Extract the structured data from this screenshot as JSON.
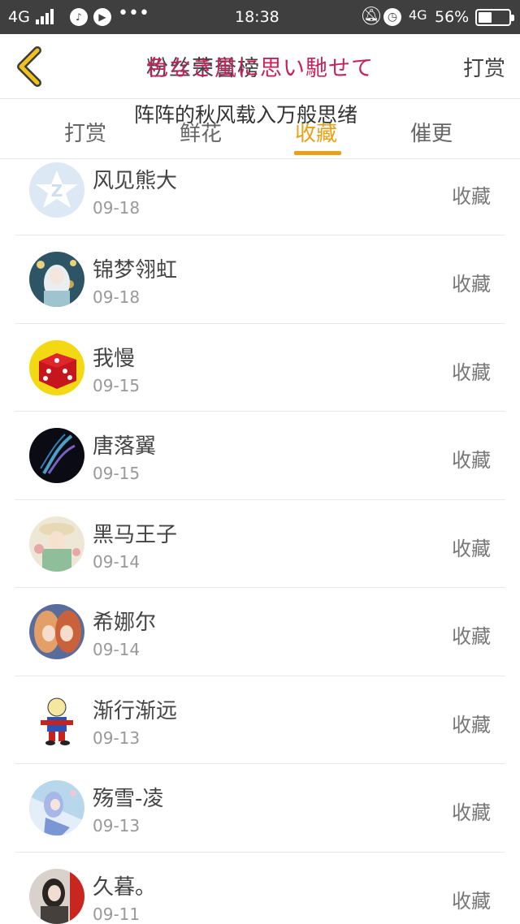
{
  "status_bar": {
    "network": "4G",
    "network_right": "4G",
    "time": "18:38",
    "battery": "56%"
  },
  "header": {
    "title": "粉丝荣誉榜",
    "title_overlay": "色なき風に思い馳せて",
    "reward_label": "打赏"
  },
  "lyric_overlay": "阵阵的秋风载入万般思绪",
  "tabs": [
    {
      "label": "打赏",
      "active": false
    },
    {
      "label": "鲜花",
      "active": false
    },
    {
      "label": "收藏",
      "active": true
    },
    {
      "label": "催更",
      "active": false
    }
  ],
  "accent_color": "#e8a114",
  "fans": [
    {
      "name": "风见熊大",
      "date": "09-18",
      "action": "收藏",
      "avatar": "qq-star-icon"
    },
    {
      "name": "锦梦翎虹",
      "date": "09-18",
      "action": "收藏",
      "avatar": "anime-girl-avatar"
    },
    {
      "name": "我慢",
      "date": "09-15",
      "action": "收藏",
      "avatar": "red-dice-icon"
    },
    {
      "name": "唐落翼",
      "date": "09-15",
      "action": "收藏",
      "avatar": "dark-feather-avatar"
    },
    {
      "name": "黑马王子",
      "date": "09-14",
      "action": "收藏",
      "avatar": "anime-boy-avatar"
    },
    {
      "name": "希娜尔",
      "date": "09-14",
      "action": "收藏",
      "avatar": "twins-avatar"
    },
    {
      "name": "渐行渐远",
      "date": "09-13",
      "action": "收藏",
      "avatar": "cartoon-kid-avatar"
    },
    {
      "name": "殇雪-凌",
      "date": "09-13",
      "action": "收藏",
      "avatar": "fantasy-girl-avatar"
    },
    {
      "name": "久暮。",
      "date": "09-11",
      "action": "收藏",
      "avatar": "photo-girl-avatar"
    }
  ]
}
